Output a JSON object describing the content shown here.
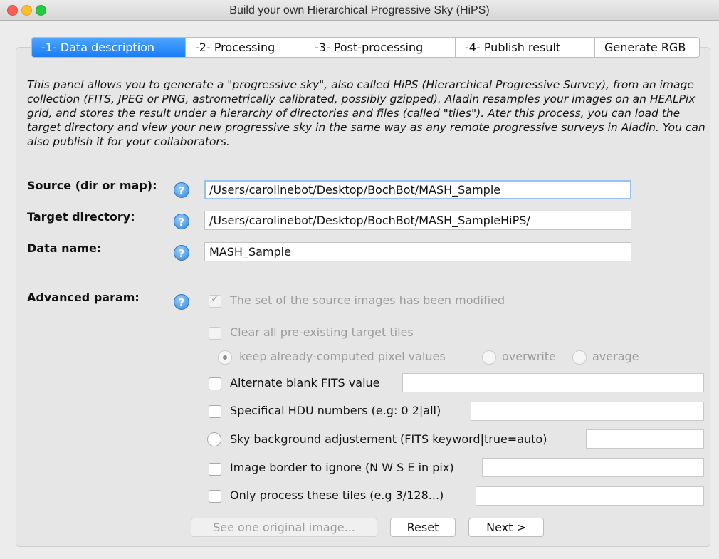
{
  "window": {
    "title": "Build your own Hierarchical Progressive Sky (HiPS)"
  },
  "tabs": [
    {
      "label": "-1- Data description",
      "active": true
    },
    {
      "label": "-2- Processing",
      "active": false
    },
    {
      "label": "-3- Post-processing",
      "active": false
    },
    {
      "label": "-4- Publish result",
      "active": false
    },
    {
      "label": "Generate RGB",
      "active": false
    }
  ],
  "description": "This panel allows you to generate a \"progressive sky\", also called HiPS (Hierarchical Progressive Survey), from an image collection (FITS, JPEG or PNG, astrometrically calibrated, possibly gzipped). Aladin resamples your images on an HEALPix grid, and stores the result under a hierarchy of directories and files (called \"tiles\"). Ater this process, you can load the target directory and view your new progressive sky in the same way as any remote progressive surveys in Aladin. You can also publish it for your collaborators.",
  "fields": {
    "source": {
      "label": "Source (dir or map):",
      "value": "/Users/carolinebot/Desktop/BochBot/MASH_Sample"
    },
    "target": {
      "label": "Target directory:",
      "value": "/Users/carolinebot/Desktop/BochBot/MASH_SampleHiPS/"
    },
    "dataname": {
      "label": "Data name:",
      "value": "MASH_Sample"
    }
  },
  "help_glyph": "?",
  "advanced": {
    "label": "Advanced param:",
    "modified": {
      "label": "The set of the source images has been modified",
      "checked": true
    },
    "clear_tiles": {
      "label": "Clear all pre-existing target tiles",
      "checked": false
    },
    "mode": {
      "options": [
        "keep already-computed pixel values",
        "overwrite",
        "average"
      ],
      "selected": "keep already-computed pixel values"
    },
    "blank": {
      "label": "Alternate blank FITS value",
      "value": ""
    },
    "hdu": {
      "label": "Specifical HDU numbers (e.g: 0 2|all)",
      "value": ""
    },
    "skybg": {
      "label": "Sky background adjustement (FITS keyword|true=auto)",
      "value": ""
    },
    "border": {
      "label": "Image border to ignore (N W S E in pix)",
      "value": ""
    },
    "tiles": {
      "label": "Only process these tiles (e.g 3/128...)",
      "value": ""
    }
  },
  "buttons": {
    "see_original": "See one original image...",
    "reset": "Reset",
    "next": "Next >"
  },
  "colors": {
    "active_tab": "#1a7cf5",
    "help_icon": "#2f86e0"
  }
}
